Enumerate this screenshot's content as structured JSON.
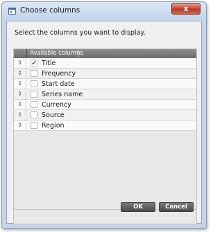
{
  "window": {
    "title": "Choose columns",
    "close_label": "x"
  },
  "instruction": "Select the columns you want to display.",
  "grid": {
    "header": "Available columns",
    "handle_glyph": "⇕",
    "check_glyph": "✓",
    "rows": [
      {
        "label": "Title",
        "checked": true
      },
      {
        "label": "Frequency",
        "checked": false
      },
      {
        "label": "Start date",
        "checked": false
      },
      {
        "label": "Series name",
        "checked": false
      },
      {
        "label": "Currency",
        "checked": false
      },
      {
        "label": "Source",
        "checked": false
      },
      {
        "label": "Region",
        "checked": false
      }
    ]
  },
  "buttons": {
    "ok": "OK",
    "cancel": "Cancel"
  },
  "colors": {
    "title_bar": "#c4d5ea",
    "close_button": "#c8503a",
    "header": "#7a7a7a",
    "button": "#5a5a5a"
  },
  "icons": {
    "app": "window-icon",
    "close": "close-icon",
    "row_handle": "drag-handle-icon",
    "checkmark": "checkmark-icon"
  }
}
